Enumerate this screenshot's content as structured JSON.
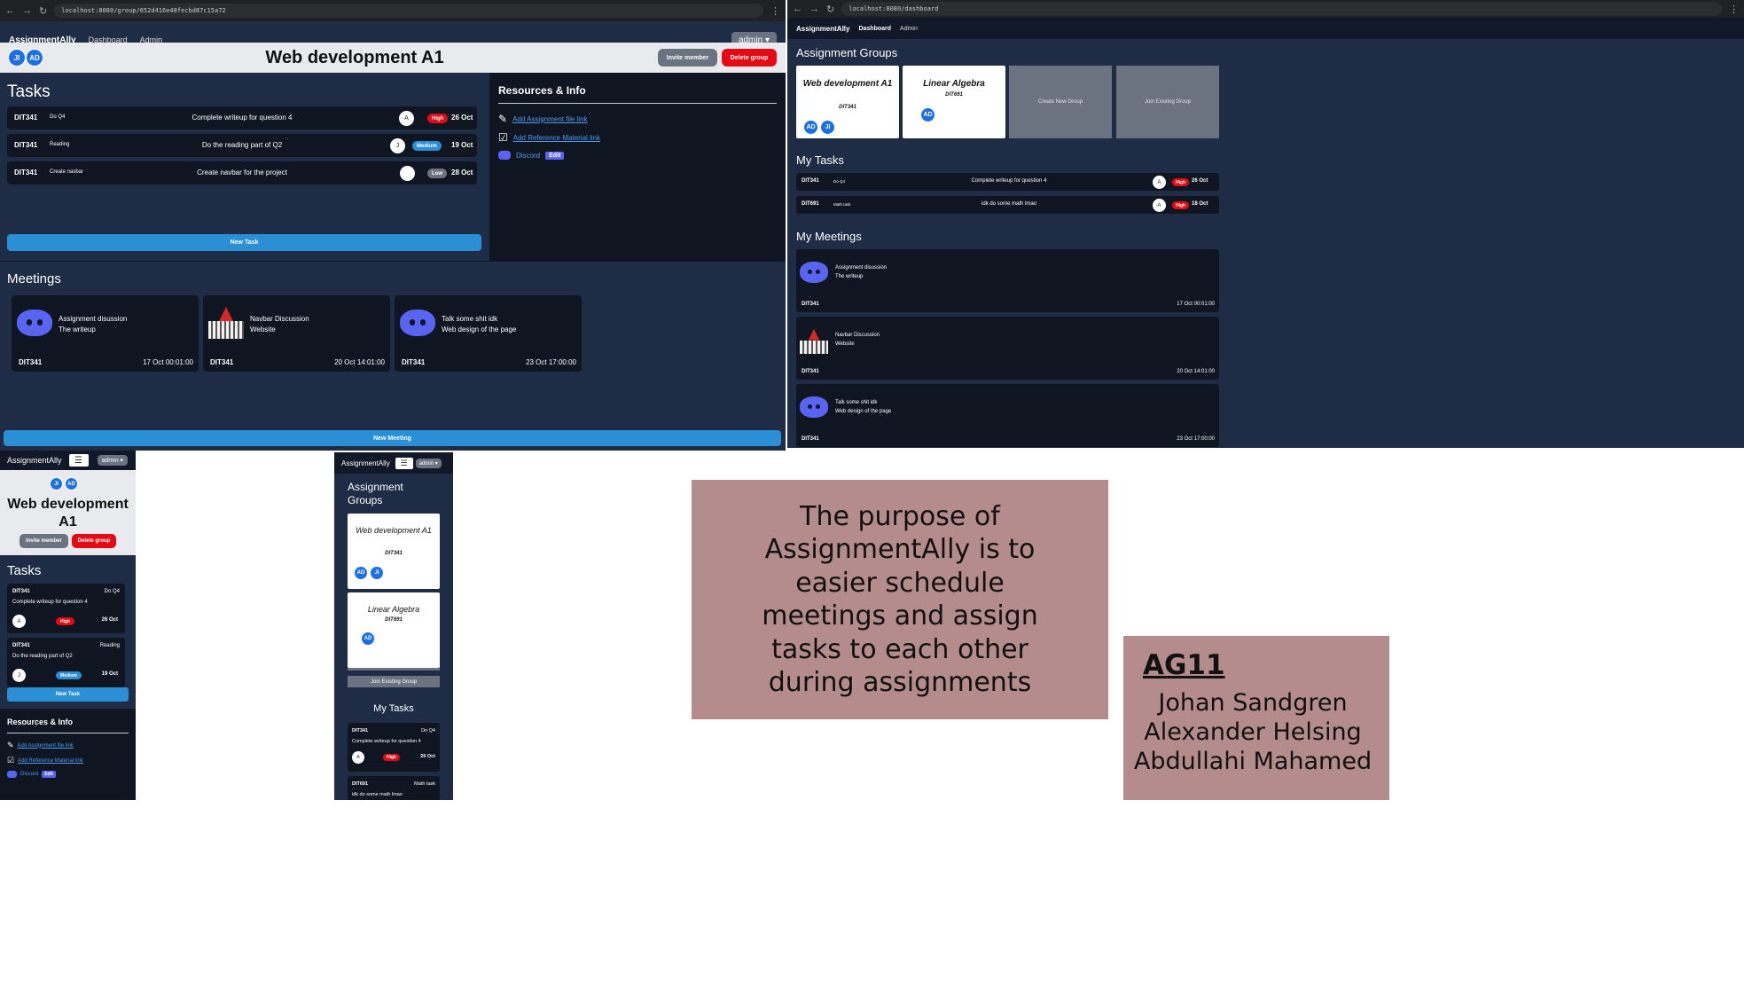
{
  "browser1": {
    "url": "localhost:8080/group/652d416e48fecbd87c15a72"
  },
  "browser2": {
    "url": "localhost:8080/dashboard"
  },
  "app": {
    "brand": "AssignmentAlly",
    "nav_dashboard": "Dashboard",
    "nav_admin": "Admin",
    "admin_button": "admin"
  },
  "group": {
    "title": "Web development A1",
    "avatars": [
      "JI",
      "AD"
    ],
    "invite": "Invite member",
    "delete": "Delete group",
    "tasks_heading": "Tasks",
    "tasks": [
      {
        "course": "DIT341",
        "short": "Do Q4",
        "title": "Complete writeup for question 4",
        "assignee": "A",
        "priority": "High",
        "date": "26 Oct"
      },
      {
        "course": "DIT341",
        "short": "Reading",
        "title": "Do the reading part of Q2",
        "assignee": "J",
        "priority": "Medium",
        "date": "19 Oct"
      },
      {
        "course": "DIT341",
        "short": "Create navbar",
        "title": "Create navbar for the project",
        "assignee": "",
        "priority": "Low",
        "date": "28 Oct"
      }
    ],
    "new_task": "New Task",
    "resources_heading": "Resources & Info",
    "resources": {
      "assignment": "Add Assignment file link",
      "reference": "Add Reference Material link",
      "discord": "Discord",
      "edit": "Edit"
    },
    "meetings_heading": "Meetings",
    "meetings": [
      {
        "title": "Assignment disussion",
        "sub": "The writeup",
        "course": "DIT341",
        "date": "17 Oct 00:01:00",
        "icon": "discord-icon"
      },
      {
        "title": "Navbar Discussion",
        "sub": "Website",
        "course": "DIT341",
        "date": "20 Oct 14:01:00",
        "icon": "building-icon"
      },
      {
        "title": "Talk some shit idk",
        "sub": "Web design of the page",
        "course": "DIT341",
        "date": "23 Oct 17:00:00",
        "icon": "discord-icon"
      }
    ],
    "new_meeting": "New Meeting"
  },
  "dashboard": {
    "groups_heading": "Assignment Groups",
    "groups": [
      {
        "name": "Web development A1",
        "course": "DIT341",
        "avatars": [
          "AD",
          "JI"
        ]
      },
      {
        "name": "Linear Algebra",
        "course": "DIT691",
        "avatars": [
          "AD"
        ]
      }
    ],
    "create_group": "Create New Group",
    "join_group": "Join Existing Group",
    "tasks_heading": "My Tasks",
    "tasks": [
      {
        "course": "DIT341",
        "short": "Do Q4",
        "title": "Complete writeup for question 4",
        "assignee": "A",
        "priority": "High",
        "date": "26 Oct"
      },
      {
        "course": "DIT691",
        "short": "Math task",
        "title": "idk do some math lmao",
        "assignee": "A",
        "priority": "High",
        "date": "18 Oct"
      }
    ],
    "meetings_heading": "My Meetings",
    "meetings": [
      {
        "title": "Assignment disussion",
        "sub": "The writeup",
        "course": "DIT341",
        "date": "17 Oct 00:01:00"
      },
      {
        "title": "Navbar Discussion",
        "sub": "Website",
        "course": "DIT341",
        "date": "20 Oct 14:01:00"
      },
      {
        "title": "Talk some shit idk",
        "sub": "Web design of the page",
        "course": "DIT341",
        "date": "23 Oct 17:00:00"
      }
    ]
  },
  "mobile_group": {
    "title": "Web development A1",
    "avatars": [
      "JI",
      "AD"
    ],
    "invite": "Invite member",
    "delete": "Delete group",
    "tasks_heading": "Tasks",
    "tasks": [
      {
        "course": "DIT341",
        "short": "Do Q4",
        "title": "Complete writeup for question 4",
        "assignee": "A",
        "priority": "High",
        "date": "26 Oct"
      },
      {
        "course": "DIT341",
        "short": "Reading",
        "title": "Do the reading part of Q2",
        "assignee": "J",
        "priority": "Medium",
        "date": "19 Oct"
      }
    ],
    "new_task": "New Task",
    "resources_heading": "Resources & Info",
    "resources": {
      "assignment": "Add Assignment file link",
      "reference": "Add Reference Material link",
      "discord": "Discord",
      "edit": "Edit"
    }
  },
  "mobile_dash": {
    "groups_heading": "Assignment Groups",
    "groups": [
      {
        "name": "Web development A1",
        "course": "DIT341",
        "avatars": [
          "AD",
          "JI"
        ]
      },
      {
        "name": "Linear Algebra",
        "course": "DIT691",
        "avatars": [
          "AD"
        ]
      }
    ],
    "create_group": "Create New Group",
    "join_group": "Join Existing Group",
    "tasks_heading": "My Tasks",
    "tasks": [
      {
        "course": "DIT341",
        "short": "Do Q4",
        "title": "Complete writeup for question 4",
        "assignee": "A",
        "priority": "High",
        "date": "26 Oct"
      },
      {
        "course": "DIT691",
        "short": "Math task",
        "title": "idk do some math lmao"
      }
    ]
  },
  "purpose": "The purpose of AssignmentAlly is to easier schedule meetings and assign tasks to each other during assignments",
  "team": {
    "code": "AG11",
    "members": [
      "Johan Sandgren",
      "Alexander Helsing",
      "Abdullahi Mahamed"
    ]
  },
  "colors": {
    "page_bg": "#1f2c45",
    "dark_card": "#0f1521",
    "blue": "#1d6fe6",
    "red": "#e50914",
    "pink_box": "#b48c8c",
    "discord": "#5865f2"
  }
}
